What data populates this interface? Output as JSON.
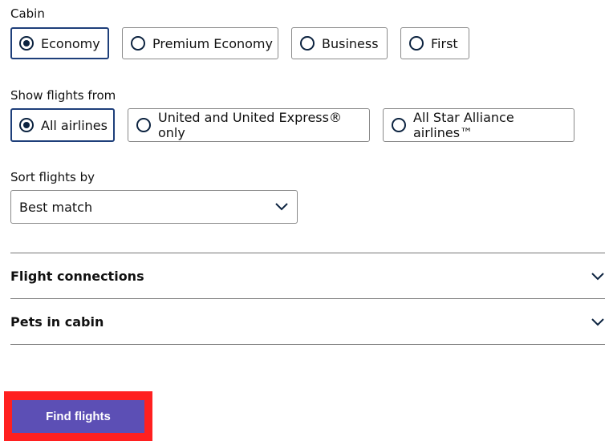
{
  "cabin": {
    "label": "Cabin",
    "options": [
      {
        "label": "Economy",
        "selected": true
      },
      {
        "label": "Premium Economy",
        "selected": false
      },
      {
        "label": "Business",
        "selected": false
      },
      {
        "label": "First",
        "selected": false
      }
    ]
  },
  "airlines": {
    "label": "Show flights from",
    "options": [
      {
        "label": "All airlines",
        "selected": true
      },
      {
        "label": "United and United Express® only",
        "selected": false
      },
      {
        "label": "All Star Alliance airlines™",
        "selected": false
      }
    ]
  },
  "sort": {
    "label": "Sort flights by",
    "value": "Best match",
    "icon": "chevron-down-icon"
  },
  "accordions": [
    {
      "label": "Flight connections",
      "icon": "chevron-down-icon"
    },
    {
      "label": "Pets in cabin",
      "icon": "chevron-down-icon"
    }
  ],
  "cta": {
    "label": "Find flights",
    "color": "#5c4fb5",
    "highlight_color": "#ff2020"
  },
  "colors": {
    "selected_border": "#1e3f7a",
    "radio": "#0c2340"
  }
}
